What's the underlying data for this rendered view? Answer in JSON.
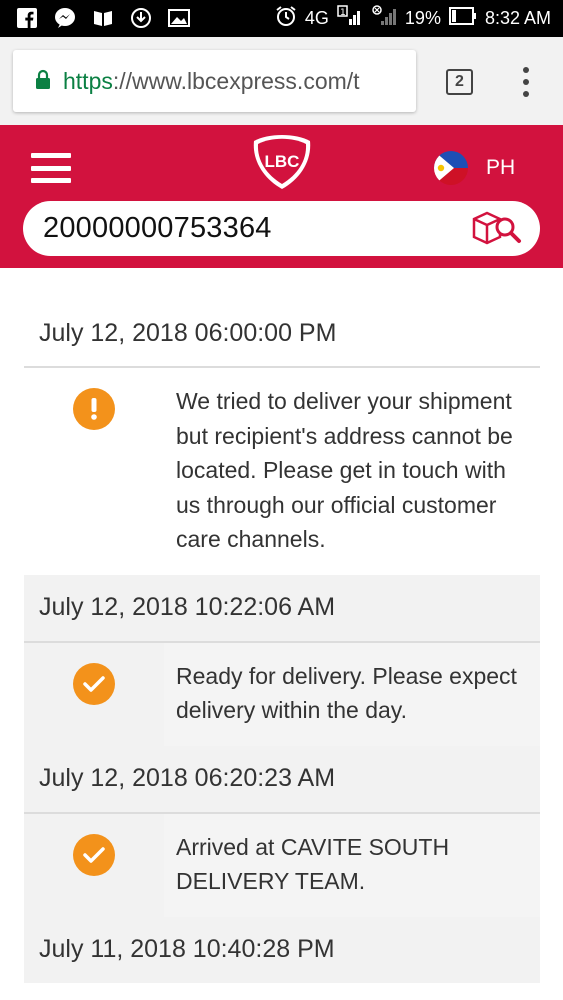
{
  "status_bar": {
    "network": "4G",
    "battery": "19%",
    "time": "8:32 AM"
  },
  "browser": {
    "url_scheme": "https",
    "url_rest": "://www.lbcexpress.com/t",
    "tab_count": "2"
  },
  "header": {
    "logo_text": "LBC",
    "country_code": "PH",
    "tracking_number": "20000000753364"
  },
  "colors": {
    "brand": "#d2123e",
    "status_icon": "#f3921b"
  },
  "timeline": [
    {
      "date": "July 12, 2018 06:00:00 PM",
      "icon": "exclamation-icon",
      "text": "We tried to deliver your shipment but recipient's address cannot be located. Please get in touch with us through our official customer care channels."
    },
    {
      "date": "July 12, 2018 10:22:06 AM",
      "icon": "checkmark-icon",
      "text": "Ready for delivery. Please expect delivery within the day."
    },
    {
      "date": "July 12, 2018 06:20:23 AM",
      "icon": "checkmark-icon",
      "text": "Arrived at CAVITE SOUTH DELIVERY TEAM."
    },
    {
      "date": "July 11, 2018 10:40:28 PM"
    }
  ]
}
